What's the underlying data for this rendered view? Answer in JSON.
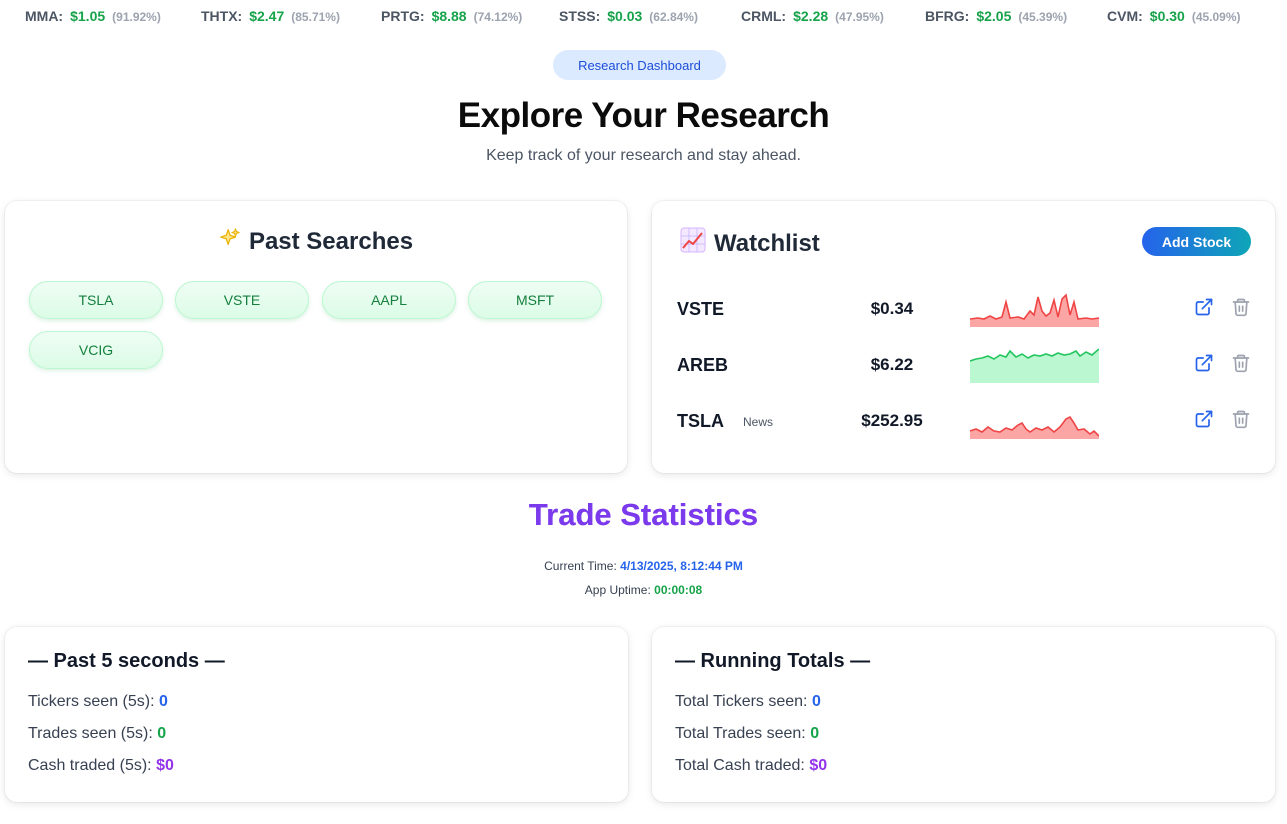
{
  "ticker": [
    {
      "symbol": "MMA:",
      "price": "$1.05",
      "pct": "(91.92%)"
    },
    {
      "symbol": "THTX:",
      "price": "$2.47",
      "pct": "(85.71%)"
    },
    {
      "symbol": "PRTG:",
      "price": "$8.88",
      "pct": "(74.12%)"
    },
    {
      "symbol": "STSS:",
      "price": "$0.03",
      "pct": "(62.84%)"
    },
    {
      "symbol": "CRML:",
      "price": "$2.28",
      "pct": "(47.95%)"
    },
    {
      "symbol": "BFRG:",
      "price": "$2.05",
      "pct": "(45.39%)"
    },
    {
      "symbol": "CVM:",
      "price": "$0.30",
      "pct": "(45.09%)"
    }
  ],
  "header": {
    "badge": "Research Dashboard",
    "title": "Explore Your Research",
    "subtitle": "Keep track of your research and stay ahead."
  },
  "past_searches": {
    "title": "Past Searches",
    "icon": "sparkles-icon",
    "chips": [
      "TSLA",
      "VSTE",
      "AAPL",
      "MSFT",
      "VCIG"
    ]
  },
  "watchlist": {
    "title": "Watchlist",
    "icon": "chart-increasing-icon",
    "add_label": "Add Stock",
    "rows": [
      {
        "symbol": "VSTE",
        "news": "",
        "price": "$0.34",
        "trend": "down",
        "color": "#ef4444",
        "fill": "#fca5a5"
      },
      {
        "symbol": "AREB",
        "news": "",
        "price": "$6.22",
        "trend": "up",
        "color": "#22c55e",
        "fill": "#bbf7d0"
      },
      {
        "symbol": "TSLA",
        "news": "News",
        "price": "$252.95",
        "trend": "down",
        "color": "#ef4444",
        "fill": "#fca5a5"
      }
    ]
  },
  "stats": {
    "title": "Trade Statistics",
    "current_time_label": "Current Time:",
    "current_time": "4/13/2025, 8:12:44 PM",
    "uptime_label": "App Uptime:",
    "uptime": "00:00:08",
    "past": {
      "heading": "— Past 5 seconds —",
      "tickers_label": "Tickers seen (5s):",
      "tickers": "0",
      "trades_label": "Trades seen (5s):",
      "trades": "0",
      "cash_label": "Cash traded (5s):",
      "cash": "$0"
    },
    "totals": {
      "heading": "— Running Totals —",
      "tickers_label": "Total Tickers seen:",
      "tickers": "0",
      "trades_label": "Total Trades seen:",
      "trades": "0",
      "cash_label": "Total Cash traded:",
      "cash": "$0"
    }
  }
}
